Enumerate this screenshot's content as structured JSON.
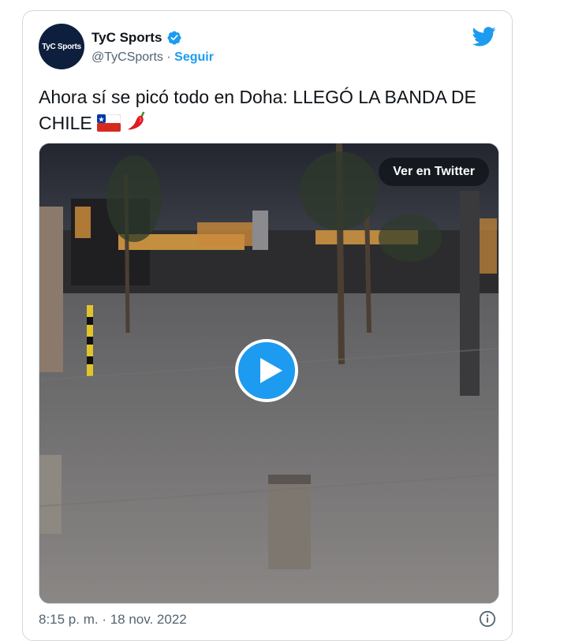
{
  "account": {
    "avatar_text": "TyC Sports",
    "name": "TyC Sports",
    "handle": "@TyCSports",
    "separator": "·",
    "follow_label": "Seguir",
    "verified_icon": "verified-badge-icon"
  },
  "tweet": {
    "text": "Ahora sí se picó todo en Doha: LLEGÓ LA BANDA DE CHILE",
    "emojis": [
      "chile-flag-icon",
      "hot-pepper-icon"
    ]
  },
  "media": {
    "button_label": "Ver en Twitter",
    "play_icon": "play-icon"
  },
  "meta": {
    "timestamp": "8:15 p. m. · 18 nov. 2022"
  },
  "colors": {
    "accent": "#1d9bf0",
    "text": "#0f1419",
    "secondary": "#536471",
    "border": "#cfd9de"
  }
}
